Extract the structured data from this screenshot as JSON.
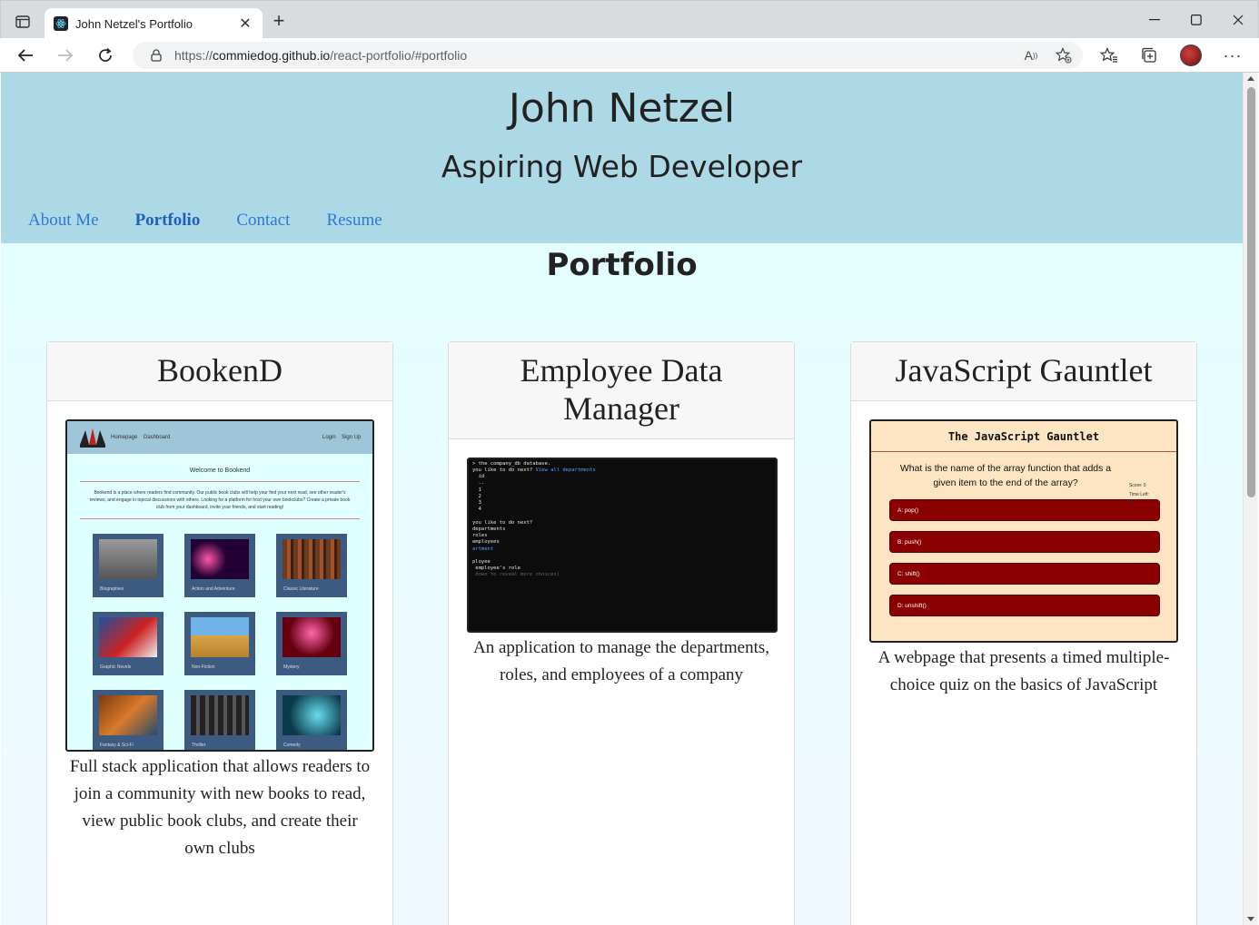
{
  "browser": {
    "tab_title": "John Netzel's Portfolio",
    "url_prefix": "https://",
    "url_host": "commiedog.github.io",
    "url_path": "/react-portfolio/#portfolio"
  },
  "header": {
    "name": "John Netzel",
    "tagline": "Aspiring Web Developer",
    "nav": [
      "About Me",
      "Portfolio",
      "Contact",
      "Resume"
    ],
    "active_nav": "Portfolio"
  },
  "section": {
    "title": "Portfolio"
  },
  "projects": [
    {
      "title": "BookenD",
      "description": "Full stack application that allows readers to join a community with new books to read, view public book clubs, and create their own clubs",
      "preview": {
        "nav_left": [
          "Homepage",
          "Dashboard"
        ],
        "nav_right": [
          "Login",
          "Sign Up"
        ],
        "welcome": "Welcome to Bookend",
        "intro": "Bookend is a place where readers find community. Our public book clubs will help your find your next read, see other reader's reviews, and engage in topical discussions with others. Looking for a platform for host your own bookclubs? Create a private book club from your dashboard, invite your friends, and start reading!",
        "genres": [
          "Biographies",
          "Action and Adventure",
          "Classic Literature",
          "Graphic Novels",
          "Non-Fiction",
          "Mystery",
          "Fantasy & Sci-Fi",
          "Thriller",
          "Comedy"
        ]
      }
    },
    {
      "title": "Employee Data Manager",
      "description": "An application to manage the departments, roles, and employees of a company",
      "preview": {
        "lines": [
          "> the company_db database.",
          "you like to do next? ",
          "  id",
          "  --",
          "  1",
          "  2",
          "  3",
          "  4",
          "",
          "you like to do next?",
          "departments",
          "roles",
          "employees",
          "artment",
          "",
          "ployee",
          " employee's role",
          " down to reveal more choices)"
        ],
        "highlight": "View all departments"
      }
    },
    {
      "title": "JavaScript Gauntlet",
      "description": "A webpage that presents a timed multiple-choice quiz on the basics of JavaScript",
      "preview": {
        "heading": "The JavaScript Gauntlet",
        "question": "What is the name of the array function that adds a given item to the end of the array?",
        "score": "Score: 0",
        "time_label": "Time Left:",
        "time_value": "46",
        "answers": [
          "A: pop()",
          "B: push()",
          "C: shift()",
          "D: unshift()"
        ]
      }
    }
  ],
  "colors": {
    "header_bg": "#add8e6",
    "page_bg": "#e0ffff",
    "nav_link": "#2a7ad8",
    "quiz_answer": "#8b0000"
  }
}
